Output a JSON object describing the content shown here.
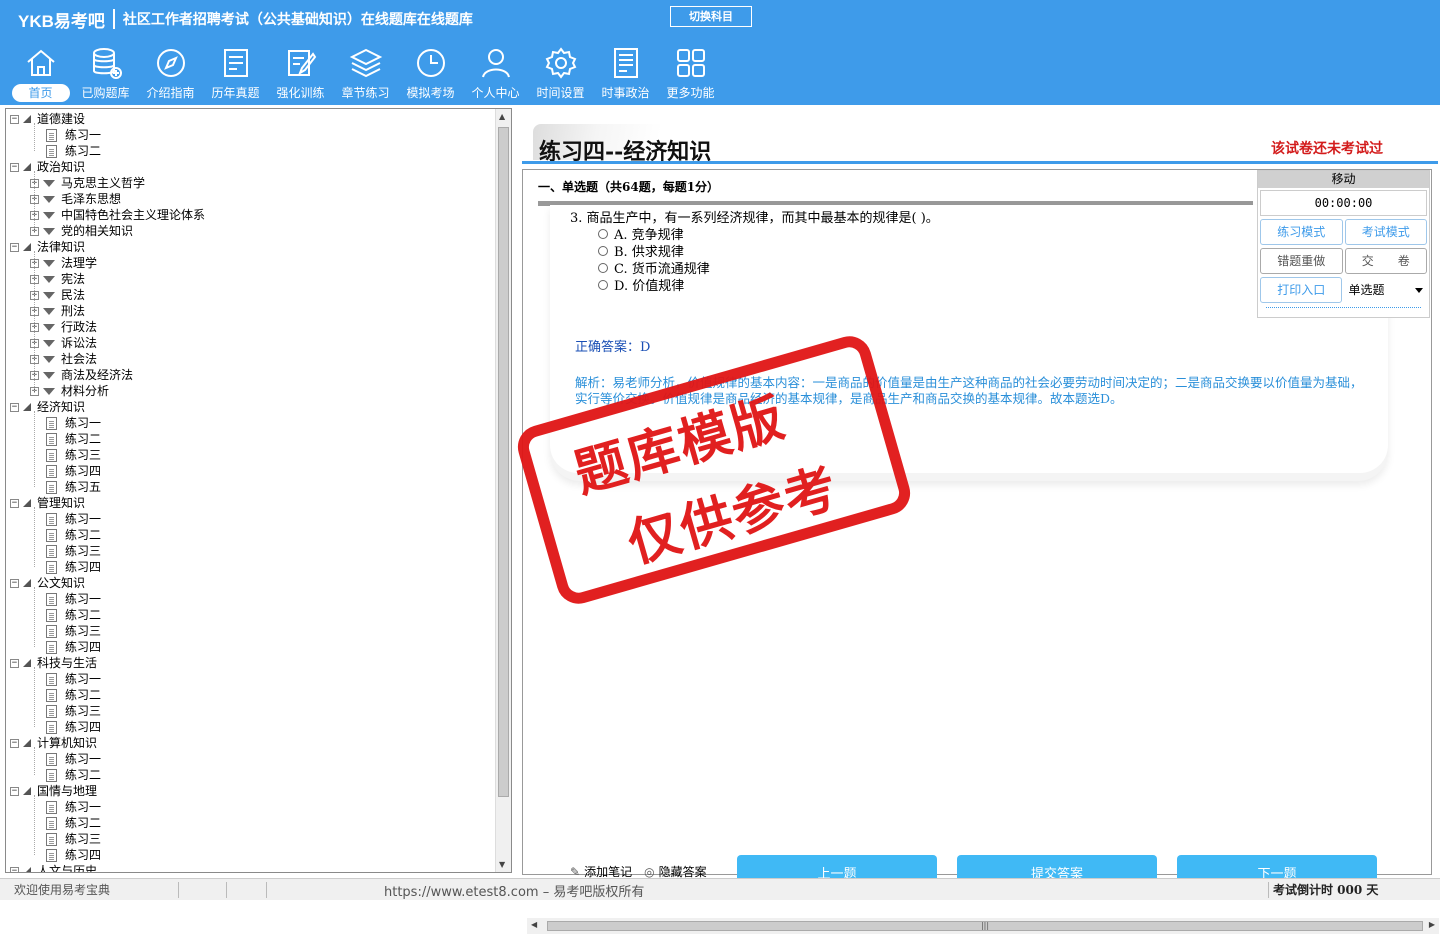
{
  "header": {
    "logo": "YKB易考吧",
    "title": "社区工作者招聘考试（公共基础知识）在线题库在线题库",
    "switch_subject": "切换科目"
  },
  "nav": [
    {
      "label": "首页",
      "icon": "home-icon"
    },
    {
      "label": "已购题库",
      "icon": "database-icon"
    },
    {
      "label": "介绍指南",
      "icon": "compass-icon"
    },
    {
      "label": "历年真题",
      "icon": "checklist-icon"
    },
    {
      "label": "强化训练",
      "icon": "edit-icon"
    },
    {
      "label": "章节练习",
      "icon": "layers-icon"
    },
    {
      "label": "模拟考场",
      "icon": "clock-icon"
    },
    {
      "label": "个人中心",
      "icon": "user-icon"
    },
    {
      "label": "时间设置",
      "icon": "gear-icon"
    },
    {
      "label": "时事政治",
      "icon": "news-icon"
    },
    {
      "label": "更多功能",
      "icon": "grid-icon"
    }
  ],
  "tree": [
    {
      "label": "道德建设",
      "children": [
        "练习一",
        "练习二"
      ]
    },
    {
      "label": "政治知识",
      "children": [
        "马克思主义哲学",
        "毛泽东思想",
        "中国特色社会主义理论体系",
        "党的相关知识"
      ],
      "folders": true
    },
    {
      "label": "法律知识",
      "children": [
        "法理学",
        "宪法",
        "民法",
        "刑法",
        "行政法",
        "诉讼法",
        "社会法",
        "商法及经济法",
        "材料分析"
      ],
      "folders": true
    },
    {
      "label": "经济知识",
      "children": [
        "练习一",
        "练习二",
        "练习三",
        "练习四",
        "练习五"
      ]
    },
    {
      "label": "管理知识",
      "children": [
        "练习一",
        "练习二",
        "练习三",
        "练习四"
      ]
    },
    {
      "label": "公文知识",
      "children": [
        "练习一",
        "练习二",
        "练习三",
        "练习四"
      ]
    },
    {
      "label": "科技与生活",
      "children": [
        "练习一",
        "练习二",
        "练习三",
        "练习四"
      ]
    },
    {
      "label": "计算机知识",
      "children": [
        "练习一",
        "练习二"
      ]
    },
    {
      "label": "国情与地理",
      "children": [
        "练习一",
        "练习二",
        "练习三",
        "练习四"
      ]
    },
    {
      "label": "人文与历史",
      "children": []
    }
  ],
  "exam": {
    "title": "练习四--经济知识",
    "status": "该试卷还未考试过",
    "section": "一、单选题（共64题，每题1分）",
    "question": "3. 商品生产中，有一系列经济规律，而其中最基本的规律是(  )。",
    "options": [
      "A. 竞争规律",
      "B. 供求规律",
      "C. 货币流通规律",
      "D. 价值规律"
    ],
    "answer": "正确答案：D",
    "analysis": "解析：易老师分析，价值规律的基本内容：一是商品的价值量是由生产这种商品的社会必要劳动时间决定的；二是商品交换要以价值量为基础，实行等价交换。价值规律是商品经济的基本规律，是商品生产和商品交换的基本规律。故本题选D。"
  },
  "panel": {
    "move": "移动",
    "timer": "00:00:00",
    "practice_mode": "练习模式",
    "exam_mode": "考试模式",
    "redo_wrong": "错题重做",
    "submit_paper": "交　　卷",
    "print": "打印入口",
    "qtype": "单选题"
  },
  "tools": {
    "add_note": "添加笔记",
    "hide_answer": "隐藏答案",
    "prev": "上一题",
    "submit": "提交答案",
    "next": "下一题"
  },
  "watermark": {
    "line1": "题库模版",
    "line2": "仅供参考"
  },
  "status": {
    "welcome": "欢迎使用易考宝典",
    "copyright": "https://www.etest8.com – 易考吧版权所有",
    "countdown": "考试倒计时 000 天"
  },
  "colors": {
    "primary": "#3e9bea",
    "button": "#40b9f5",
    "warning": "#d31c1c",
    "answer": "#1a4fb5",
    "analysis": "#2a8fd9"
  }
}
